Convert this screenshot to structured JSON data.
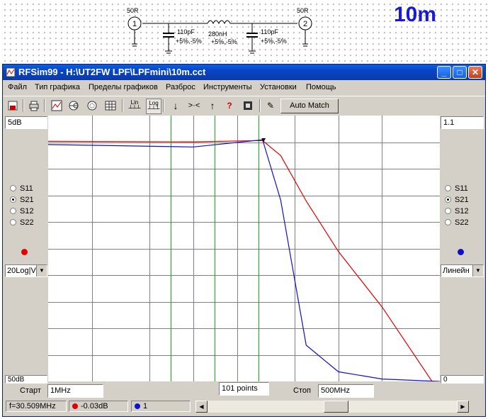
{
  "schematic": {
    "port1": {
      "impedance": "50R",
      "number": "1"
    },
    "port2": {
      "impedance": "50R",
      "number": "2"
    },
    "cap1": {
      "value": "110pF",
      "tolerance": "+5%,-5%"
    },
    "inductor": {
      "value": "280nH",
      "tolerance": "+5%,-5%"
    },
    "cap2": {
      "value": "110pF",
      "tolerance": "+5%,-5%"
    },
    "band_label": "10m"
  },
  "window": {
    "title": "RFSim99 - H:\\UT2FW LPF\\LPFmini\\10m.cct",
    "controls": {
      "minimize": "_",
      "maximize": "□",
      "close": "✕"
    }
  },
  "menu": [
    "Файл",
    "Тип графика",
    "Пределы графиков",
    "Разброс",
    "Инструменты",
    "Установки",
    "Помощь"
  ],
  "toolbar": {
    "icons": [
      "save-icon",
      "print-icon",
      "graph-icon",
      "smith-icon",
      "polar-icon",
      "table-icon",
      "lin-icon",
      "log-icon",
      "marker-down-icon",
      "marker-between-icon",
      "marker-up-icon",
      "help-icon",
      "component-icon",
      "tune-icon"
    ],
    "lin_label": "Lin",
    "log_label": "Log",
    "auto_match": "Auto Match"
  },
  "left_panel": {
    "scale_top": "5dB",
    "scale_bottom": "50dB",
    "params": [
      "S11",
      "S21",
      "S12",
      "S22"
    ],
    "selected": "S21",
    "marker_color": "#e00000",
    "mode": "20Log|V"
  },
  "right_panel": {
    "scale_top": "1.1",
    "scale_bottom": "0",
    "params": [
      "S11",
      "S21",
      "S12",
      "S22"
    ],
    "selected": "S21",
    "marker_color": "#1010c8",
    "mode": "Линейн"
  },
  "bottom": {
    "start_label": "Старт",
    "start_value": "1MHz",
    "points_value": "101 points",
    "stop_label": "Стоп",
    "stop_value": "500MHz"
  },
  "status": {
    "freq": "f=30.509MHz",
    "red_value": "-0.03dB",
    "blue_value": "1",
    "red_color": "#e00000",
    "blue_color": "#1010c8"
  },
  "chart_data": {
    "type": "line",
    "x_scale": "log",
    "xlim": [
      "1MHz",
      "500MHz"
    ],
    "grid": true,
    "series": [
      {
        "color": "#e00000",
        "axis": "left (dB)",
        "x": [
          1,
          10,
          30,
          40,
          60,
          100,
          200,
          500
        ],
        "y": [
          -0.2,
          -0.3,
          -0.03,
          -3,
          -12,
          -22,
          -33,
          -50
        ]
      },
      {
        "color": "#1010c8",
        "axis": "right (linear)",
        "x": [
          1,
          10,
          30,
          40,
          60,
          100,
          200,
          500
        ],
        "y": [
          0.98,
          0.97,
          1.0,
          0.75,
          0.15,
          0.04,
          0.01,
          0.0
        ]
      }
    ],
    "markers_mhz": [
      7,
      14,
      28
    ]
  }
}
